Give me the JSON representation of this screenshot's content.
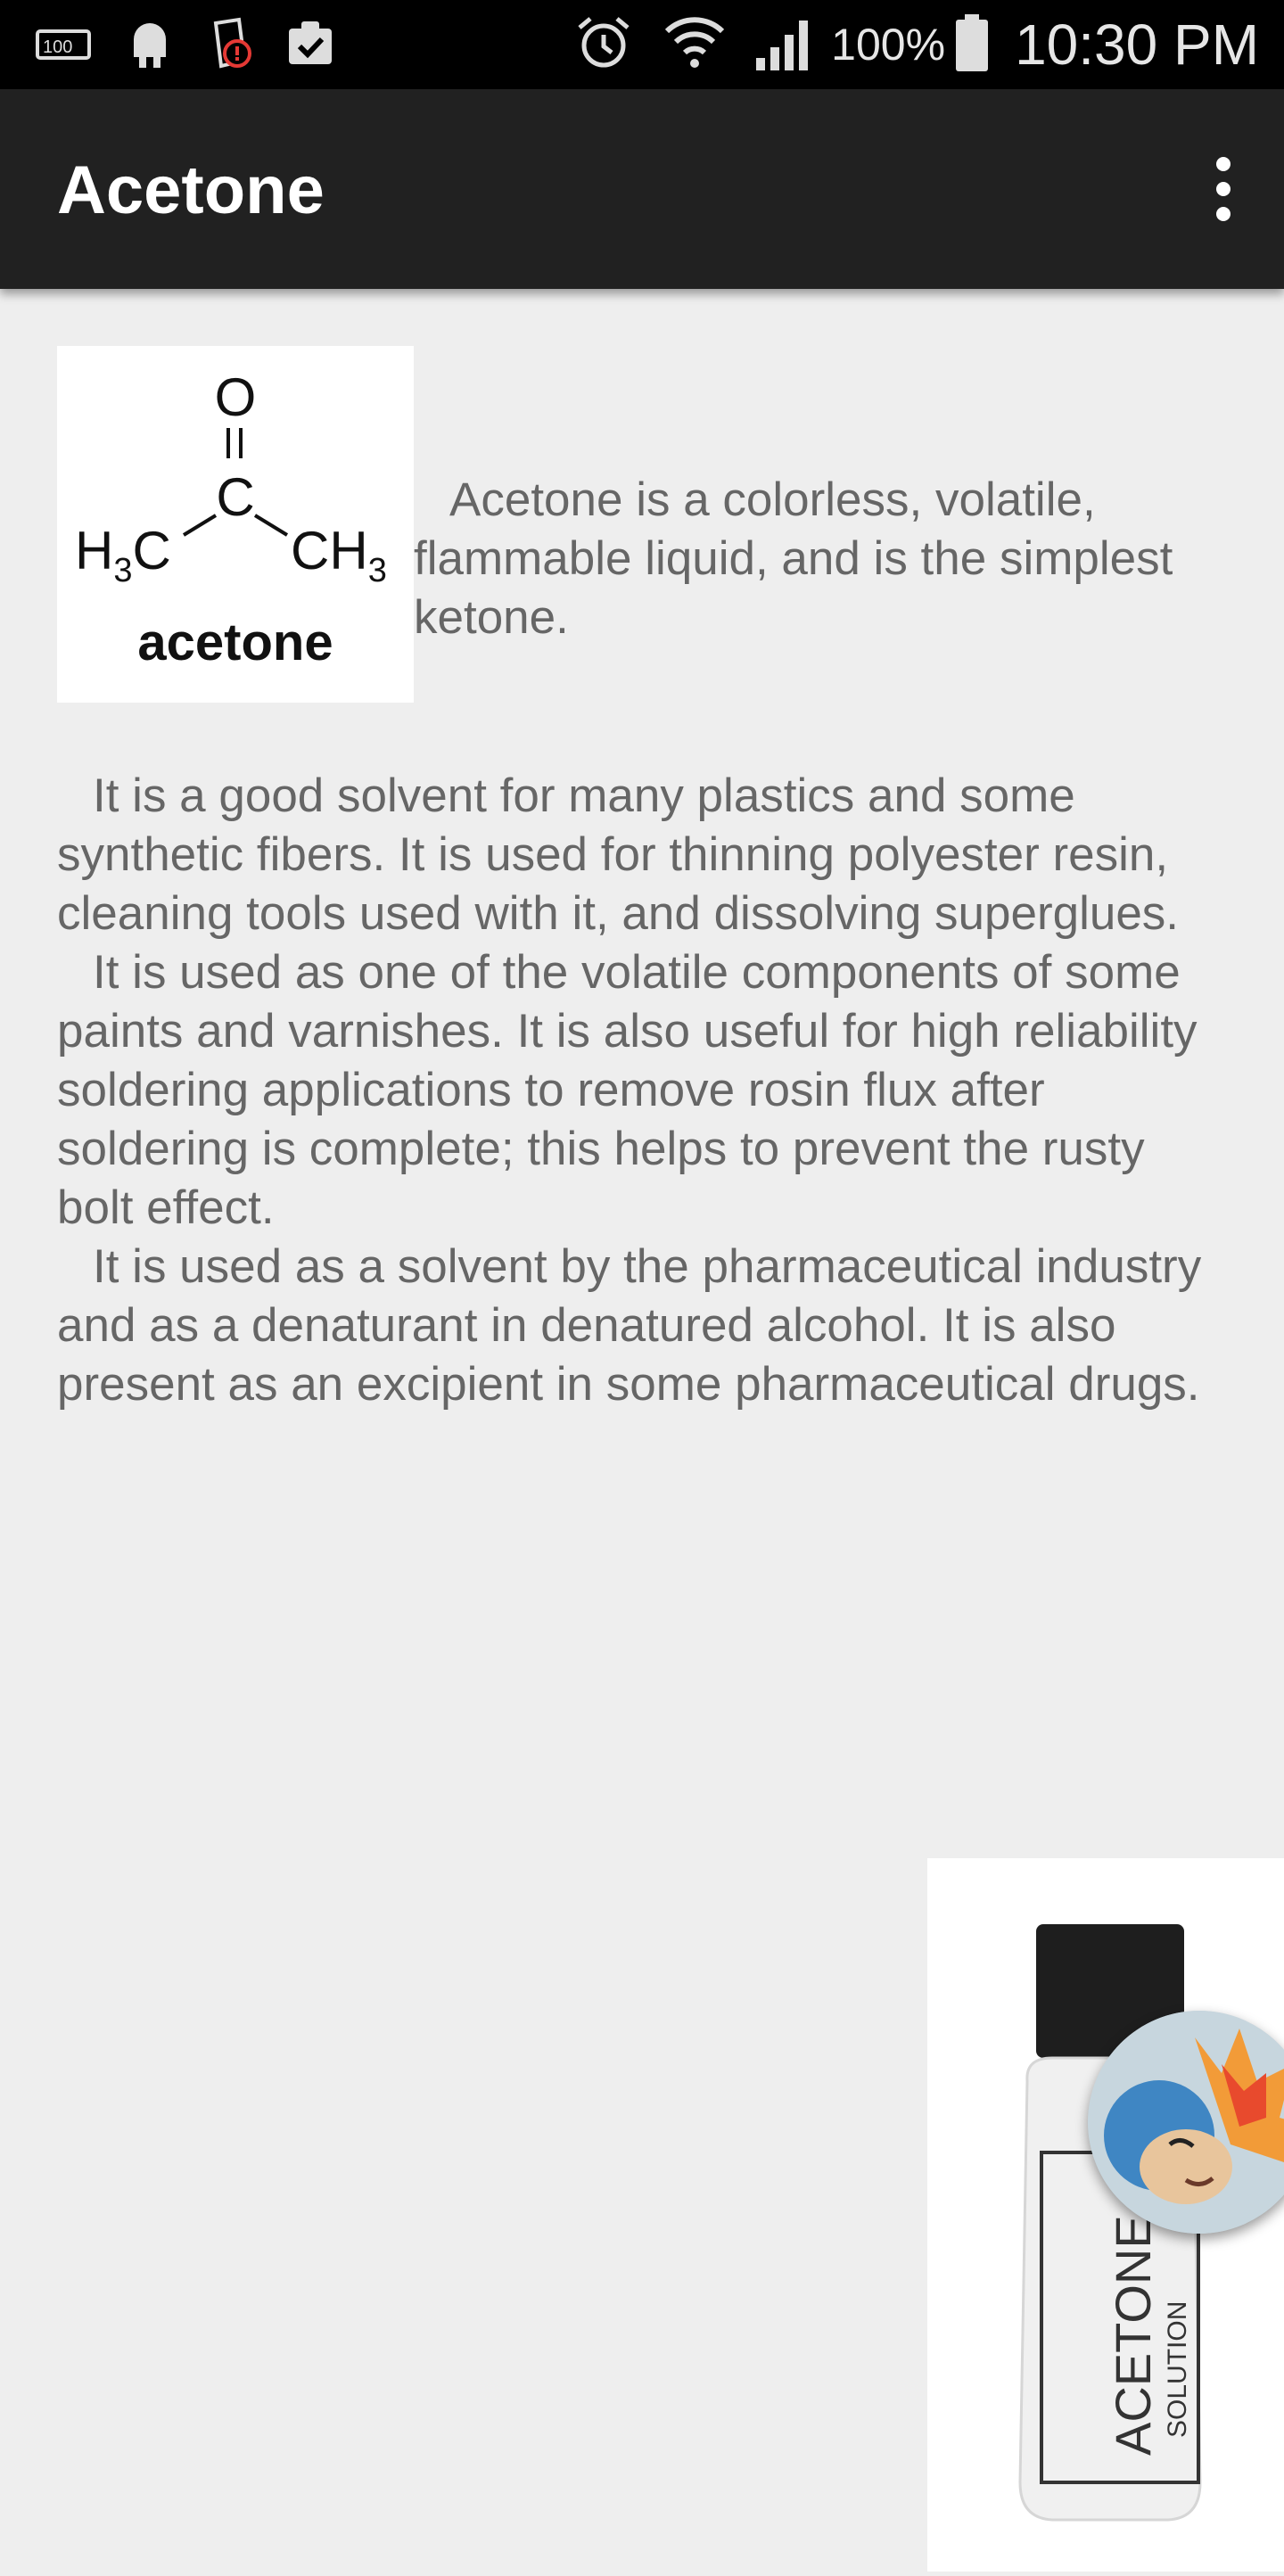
{
  "status_bar": {
    "icons": [
      "storage-100-icon",
      "android-icon",
      "drink-alert-icon",
      "clipboard-check-icon",
      "alarm-icon",
      "wifi-icon",
      "signal-icon",
      "battery-icon"
    ],
    "battery_percent": "100%",
    "time": "10:30 PM"
  },
  "app_bar": {
    "title": "Acetone",
    "overflow_icon": "more-vert-icon"
  },
  "content": {
    "structure_image": {
      "oxygen": "O",
      "carbon": "C",
      "left_group": "H3C",
      "right_group": "CH3",
      "caption": "acetone"
    },
    "lead_paragraph": "Acetone is a colorless, volatile, flammable liquid, and is the simplest ketone.",
    "paragraphs": [
      "It is a good solvent for many plastics and some synthetic fibers. It is used for thinning polyester resin, cleaning tools used with it, and dissolving superglues.",
      "It is used as one of the volatile components of some paints and varnishes. It is also useful for high reliability soldering applications to remove rosin flux after soldering is complete; this helps to prevent the rusty bolt effect.",
      "It is used as a solvent by the pharmaceutical industry and as a denaturant in denatured alcohol. It is also present as an excipient in some pharmaceutical drugs."
    ],
    "bottle_image": {
      "label": "ACETONE",
      "sublabel": "SOLUTION"
    }
  },
  "colors": {
    "status_bar": "#000000",
    "app_bar": "#212121",
    "background": "#eeeeee",
    "text": "#666666"
  }
}
